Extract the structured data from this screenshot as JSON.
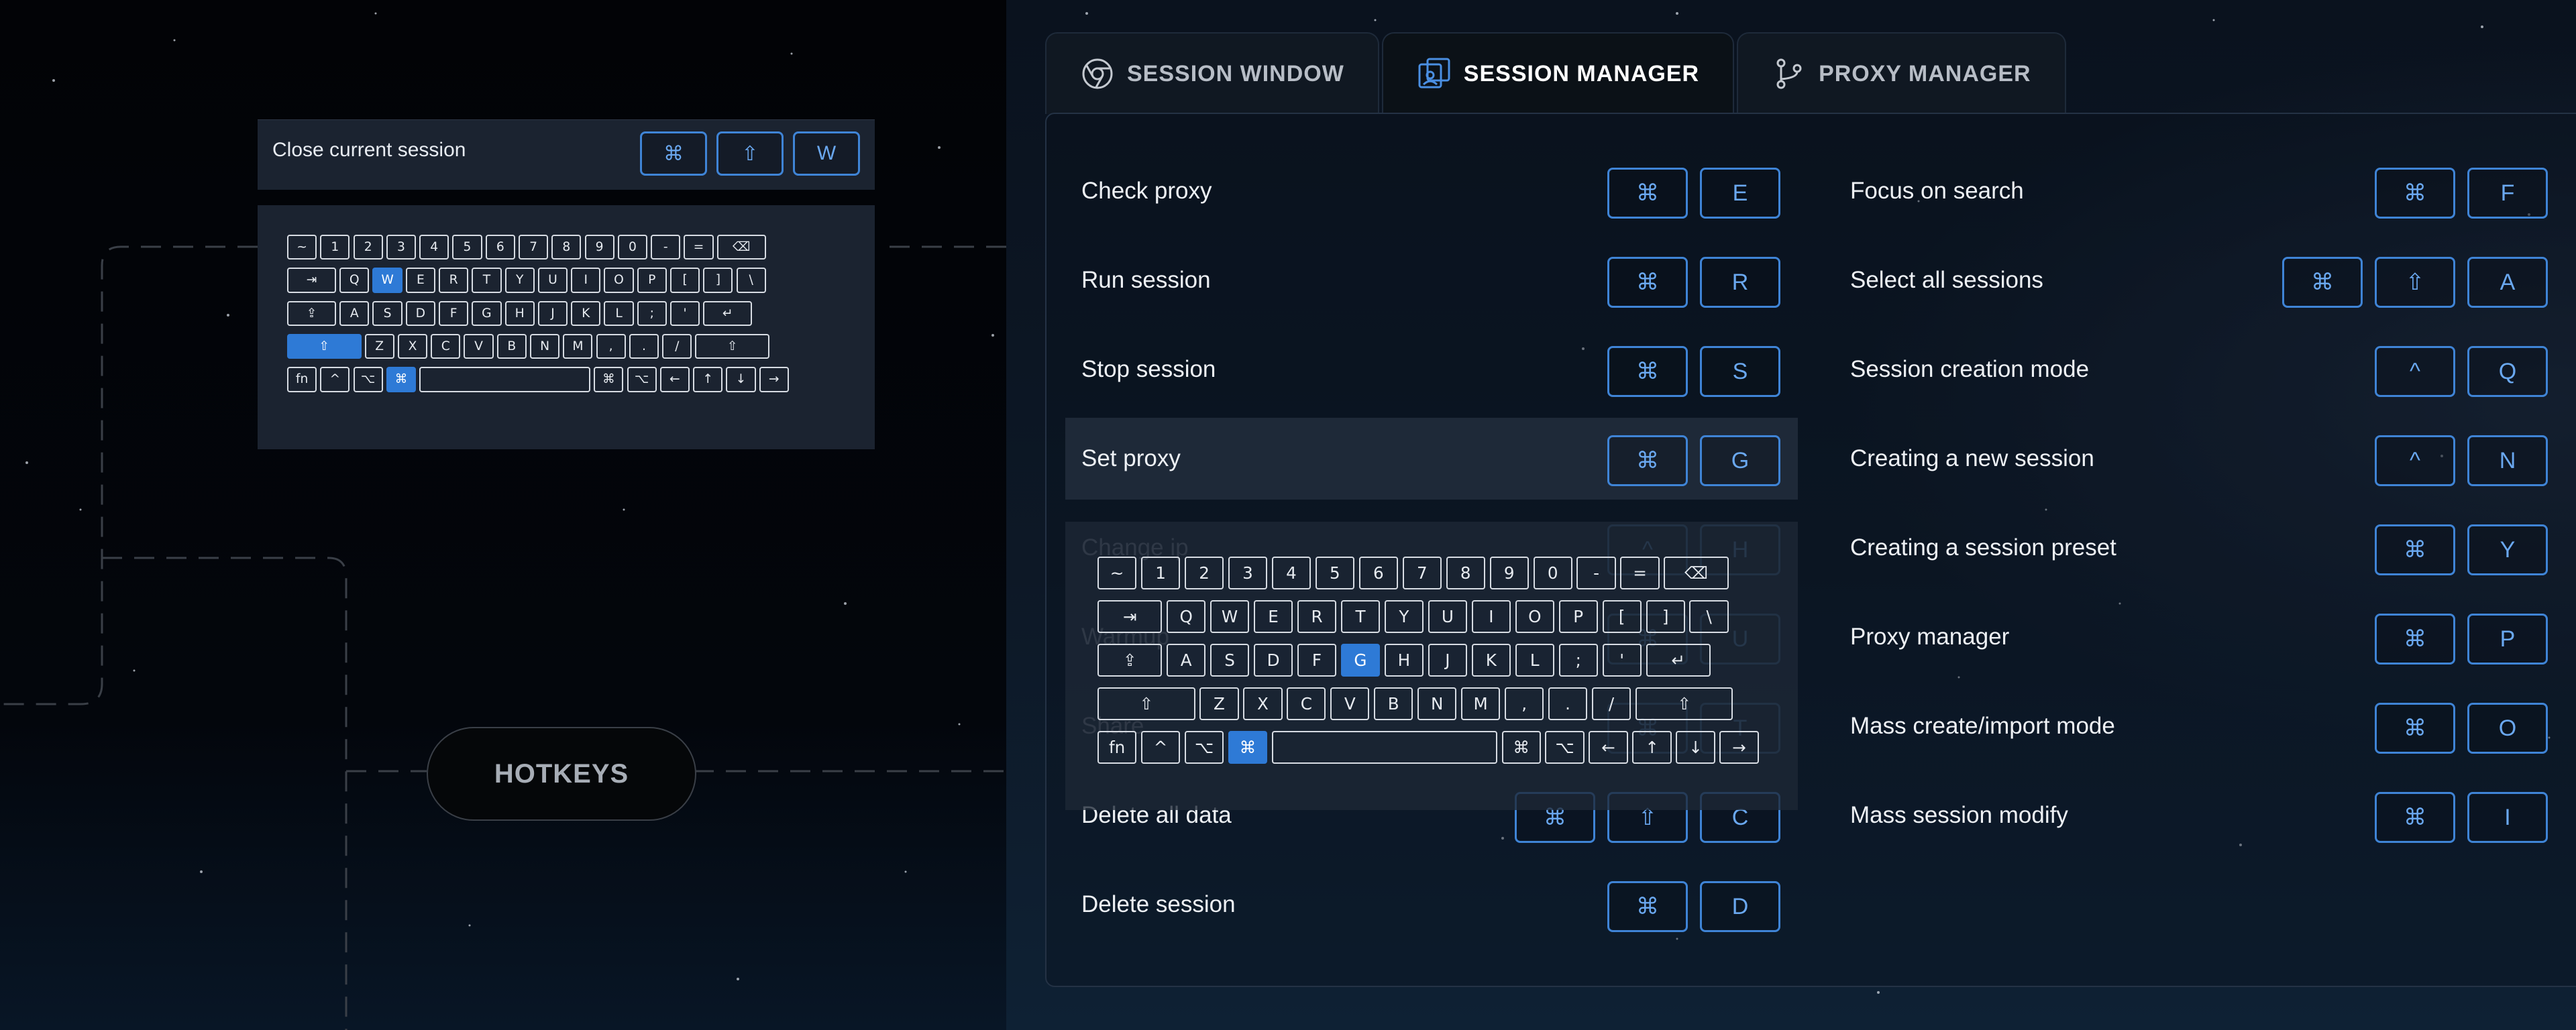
{
  "hotkeys_button": {
    "label": "HOTKEYS"
  },
  "tabs": [
    {
      "label": "SESSION WINDOW",
      "icon": "chrome-icon",
      "active": false
    },
    {
      "label": "SESSION MANAGER",
      "icon": "user-window-icon",
      "active": true
    },
    {
      "label": "PROXY MANAGER",
      "icon": "branch-icon",
      "active": false
    }
  ],
  "mini_preview": {
    "label": "Close current session",
    "keys": [
      "⌘",
      "⇧",
      "W"
    ],
    "highlighted_keys": [
      "W",
      "⇧",
      "⌘"
    ]
  },
  "left_column": [
    {
      "label": "Check proxy",
      "keys": [
        "⌘",
        "E"
      ]
    },
    {
      "label": "Run session",
      "keys": [
        "⌘",
        "R"
      ]
    },
    {
      "label": "Stop session",
      "keys": [
        "⌘",
        "S"
      ]
    },
    {
      "label": "Set proxy",
      "keys": [
        "⌘",
        "G"
      ],
      "highlight": true
    },
    {
      "label": "Change ip",
      "keys": [
        "^",
        "H"
      ],
      "obscured": true
    },
    {
      "label": "Warmup",
      "keys": [
        "⌘",
        "U"
      ],
      "obscured": true
    },
    {
      "label": "Share",
      "keys": [
        "⌘",
        "T"
      ],
      "obscured": true
    },
    {
      "label": "Delete all data",
      "keys": [
        "⌘",
        "⇧",
        "C"
      ]
    },
    {
      "label": "Delete session",
      "keys": [
        "⌘",
        "D"
      ]
    }
  ],
  "right_column": [
    {
      "label": "Focus on search",
      "keys": [
        "⌘",
        "F"
      ]
    },
    {
      "label": "Select all sessions",
      "keys": [
        "⌘",
        "⇧",
        "A"
      ]
    },
    {
      "label": "Session creation mode",
      "keys": [
        "^",
        "Q"
      ]
    },
    {
      "label": "Creating a new session",
      "keys": [
        "^",
        "N"
      ]
    },
    {
      "label": "Creating a session preset",
      "keys": [
        "⌘",
        "Y"
      ]
    },
    {
      "label": "Proxy manager",
      "keys": [
        "⌘",
        "P"
      ]
    },
    {
      "label": "Mass create/import mode",
      "keys": [
        "⌘",
        "O"
      ]
    },
    {
      "label": "Mass session modify",
      "keys": [
        "⌘",
        "I"
      ]
    }
  ],
  "keyboard": {
    "row1": [
      "~",
      "1",
      "2",
      "3",
      "4",
      "5",
      "6",
      "7",
      "8",
      "9",
      "0",
      "-",
      "=",
      "⌫"
    ],
    "row2": [
      "⇥",
      "Q",
      "W",
      "E",
      "R",
      "T",
      "Y",
      "U",
      "I",
      "O",
      "P",
      "[",
      "]",
      "\\"
    ],
    "row3": [
      "⇪",
      "A",
      "S",
      "D",
      "F",
      "G",
      "H",
      "J",
      "K",
      "L",
      ";",
      "'",
      "↵"
    ],
    "row4": [
      "⇧",
      "Z",
      "X",
      "C",
      "V",
      "B",
      "N",
      "M",
      ",",
      ".",
      "/",
      "⇧"
    ],
    "row5": [
      "fn",
      "^",
      "⌥",
      "⌘",
      "",
      "⌘",
      "⌥",
      "←",
      "↑",
      "↓",
      "→"
    ]
  },
  "big_keyboard_highlight": [
    "G",
    "⌘"
  ],
  "accent_color": "#2e7ad6"
}
